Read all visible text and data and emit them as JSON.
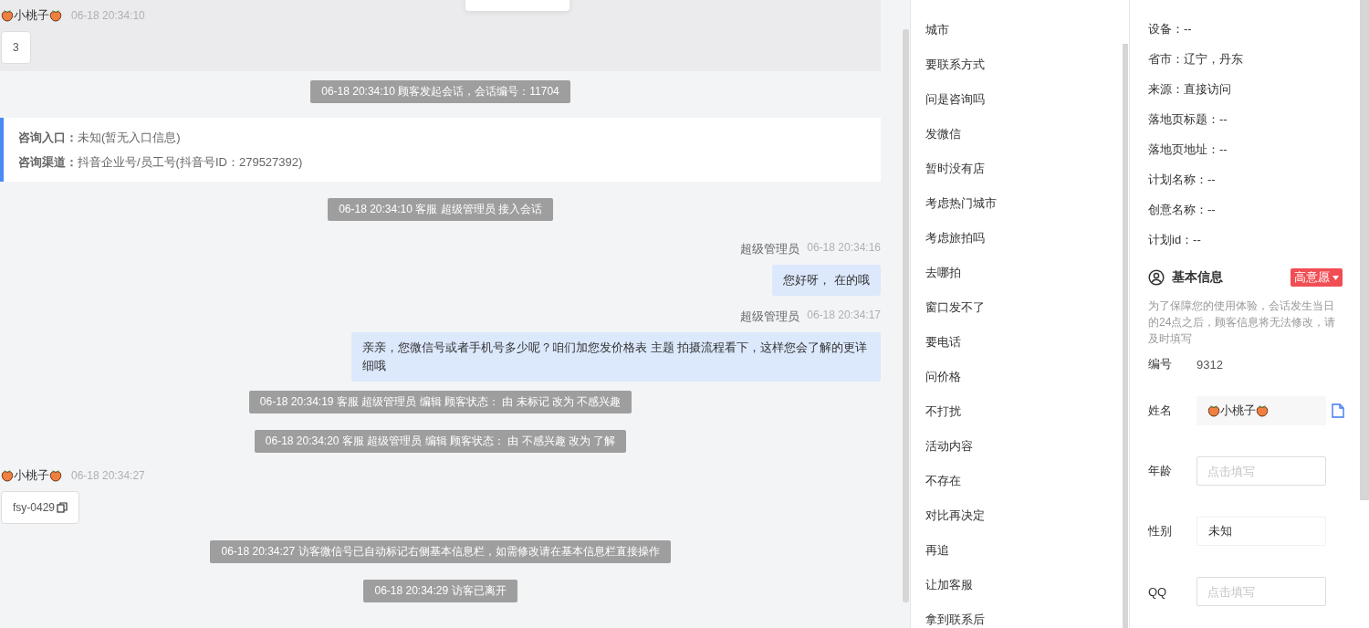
{
  "chat": {
    "messages": [
      {
        "kind": "visitor",
        "name": "小桃子",
        "time": "06-18 20:34:10",
        "text": "3",
        "highlighted": true,
        "copyable": false
      },
      {
        "kind": "system",
        "text": "06-18 20:34:10 顾客发起会话，会话编号：11704"
      },
      {
        "kind": "source",
        "lines": [
          {
            "label": "咨询入口：",
            "value": "未知(暂无入口信息)"
          },
          {
            "label": "咨询渠道：",
            "value": "抖音企业号/员工号(抖音号ID：279527392)"
          }
        ]
      },
      {
        "kind": "system",
        "text": "06-18 20:34:10 客服 超级管理员 接入会话"
      },
      {
        "kind": "agent",
        "name": "超级管理员",
        "time": "06-18 20:34:16",
        "text": "您好呀， 在的哦"
      },
      {
        "kind": "agent",
        "name": "超级管理员",
        "time": "06-18 20:34:17",
        "text": "亲亲，您微信号或者手机号多少呢？咱们加您发价格表 主题 拍摄流程看下，这样您会了解的更详细哦"
      },
      {
        "kind": "system",
        "text": "06-18 20:34:19 客服 超级管理员 编辑 顾客状态： 由 未标记 改为 不感兴趣"
      },
      {
        "kind": "system",
        "text": "06-18 20:34:20 客服 超级管理员 编辑 顾客状态： 由 不感兴趣 改为 了解"
      },
      {
        "kind": "visitor",
        "name": "小桃子",
        "time": "06-18 20:34:27",
        "text": "fsy-0429",
        "highlighted": false,
        "copyable": true
      },
      {
        "kind": "system",
        "text": "06-18 20:34:27 访客微信号已自动标记右侧基本信息栏，如需修改请在基本信息栏直接操作"
      },
      {
        "kind": "system",
        "text": "06-18 20:34:29 访客已离开"
      }
    ]
  },
  "quick_replies": [
    "城市",
    "要联系方式",
    "问是咨询吗",
    "发微信",
    "暂时没有店",
    "考虑热门城市",
    "考虑旅拍吗",
    "去哪拍",
    "窗口发不了",
    "要电话",
    "问价格",
    "不打扰",
    "活动内容",
    "不存在",
    "对比再决定",
    "再追",
    "让加客服",
    "拿到联系后"
  ],
  "visitor_info": {
    "lines": [
      "设备：--",
      "省市：辽宁，丹东",
      "来源：直接访问",
      "落地页标题：--",
      "落地页地址：--",
      "计划名称：--",
      "创意名称：--",
      "计划id：--"
    ],
    "basic": {
      "title": "基本信息",
      "tag": "高意愿",
      "note": "为了保障您的使用体验，会话发生当日的24点之后，顾客信息将无法修改，请及时填写",
      "fields": [
        {
          "kind": "text",
          "label": "编号",
          "value": "9312"
        },
        {
          "kind": "name",
          "label": "姓名",
          "value": "小桃子"
        },
        {
          "kind": "input",
          "label": "年龄",
          "placeholder": "点击填写"
        },
        {
          "kind": "select",
          "label": "性别",
          "value": "未知"
        },
        {
          "kind": "input",
          "label": "QQ",
          "placeholder": "点击填写"
        }
      ]
    }
  }
}
